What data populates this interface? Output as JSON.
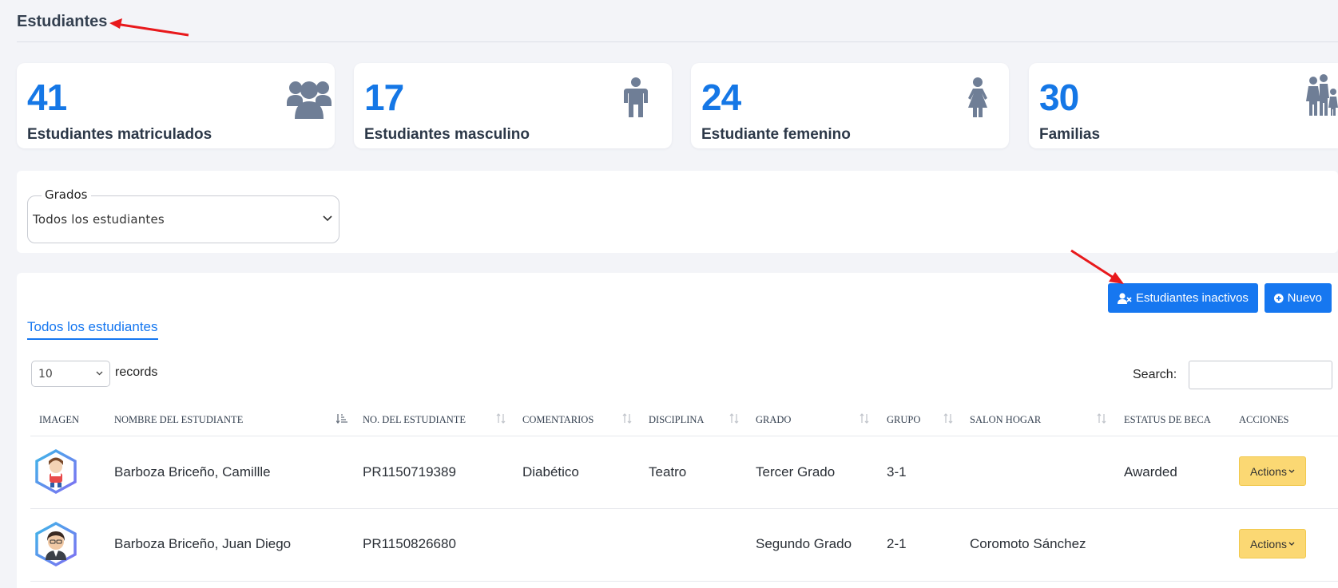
{
  "page": {
    "title": "Estudiantes"
  },
  "stats": [
    {
      "value": "41",
      "label": "Estudiantes matriculados",
      "icon": "users-group-icon"
    },
    {
      "value": "17",
      "label": "Estudiantes masculino",
      "icon": "male-icon"
    },
    {
      "value": "24",
      "label": "Estudiante femenino",
      "icon": "female-icon"
    },
    {
      "value": "30",
      "label": "Familias",
      "icon": "family-icon"
    }
  ],
  "filter": {
    "legend": "Grados",
    "selected": "Todos los estudiantes"
  },
  "toolbar": {
    "inactive_label": "Estudiantes inactivos",
    "new_label": "Nuevo"
  },
  "tab": {
    "label": "Todos los estudiantes"
  },
  "table": {
    "length_value": "10",
    "records_label": "records",
    "search_label": "Search:",
    "columns": [
      "IMAGEN",
      "NOMBRE DEL ESTUDIANTE",
      "NO. DEL ESTUDIANTE",
      "COMENTARIOS",
      "DISCIPLINA",
      "GRADO",
      "GRUPO",
      "SALON HOGAR",
      "ESTATUS DE BECA",
      "ACCIONES"
    ],
    "rows": [
      {
        "name": "Barboza Briceño, Camillle",
        "number": "PR1150719389",
        "comments": "Diabético",
        "discipline": "Teatro",
        "grade": "Tercer Grado",
        "group": "3-1",
        "homeroom": "",
        "scholarship": "Awarded",
        "action": "Actions"
      },
      {
        "name": "Barboza Briceño, Juan Diego",
        "number": "PR1150826680",
        "comments": "",
        "discipline": "",
        "grade": "Segundo Grado",
        "group": "2-1",
        "homeroom": "Coromoto Sánchez",
        "scholarship": "",
        "action": "Actions"
      }
    ]
  },
  "colors": {
    "accent": "#1677f0",
    "stat_number": "#1577e6",
    "action_button": "#fbd873",
    "annotation_arrow": "#e8191c"
  }
}
